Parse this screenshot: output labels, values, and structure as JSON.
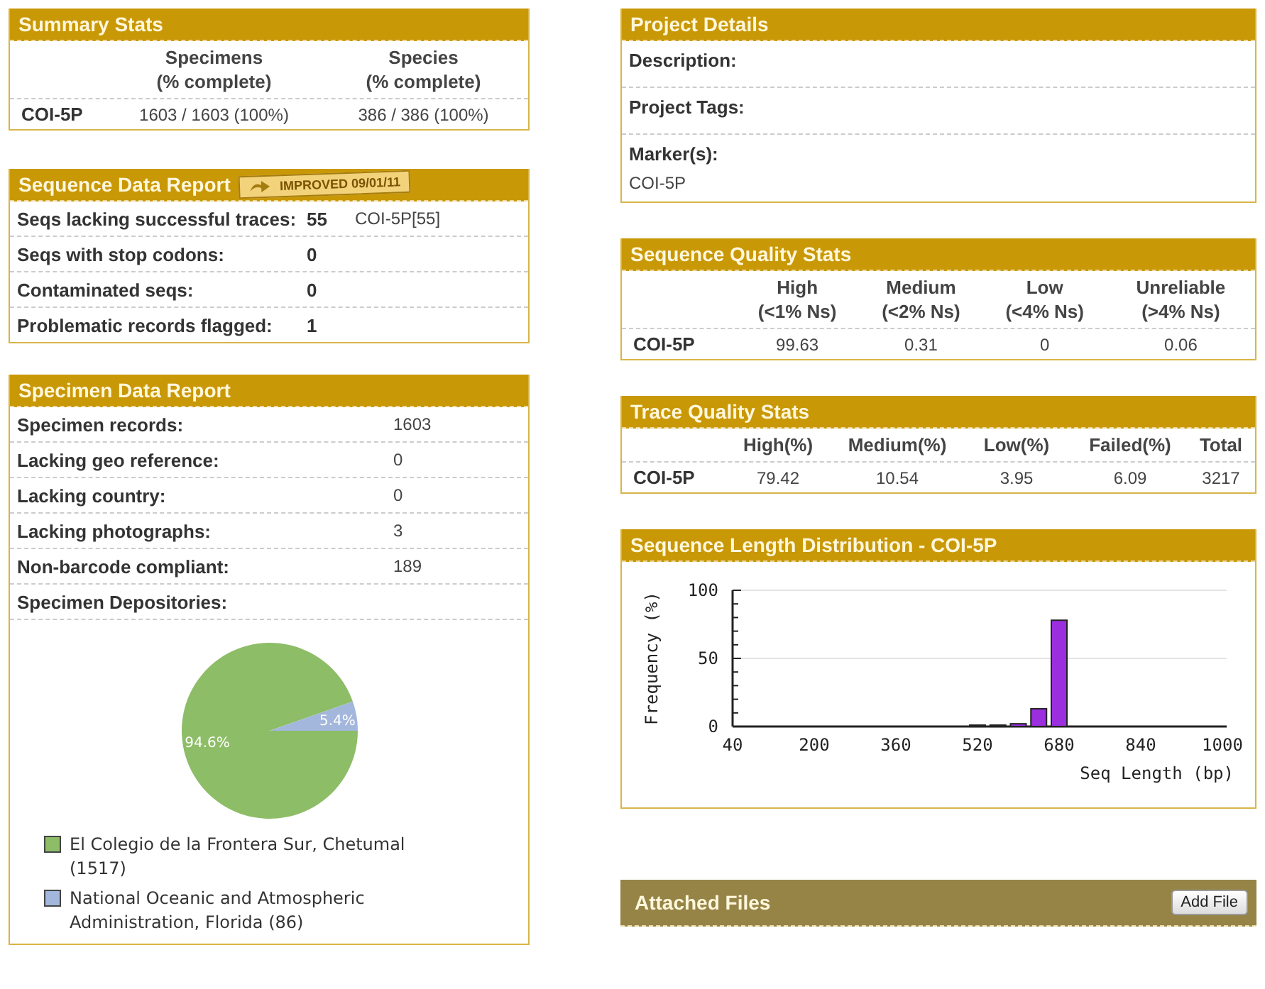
{
  "summary_stats": {
    "title": "Summary Stats",
    "columns": [
      {
        "label": "Specimens",
        "sub": "(% complete)"
      },
      {
        "label": "Species",
        "sub": "(% complete)"
      }
    ],
    "rows": [
      {
        "marker": "COI-5P",
        "cells": [
          "1603 / 1603  (100%)",
          "386 / 386  (100%)"
        ]
      }
    ]
  },
  "sequence_data_report": {
    "title": "Sequence Data Report",
    "badge": {
      "text": "IMPROVED",
      "date": "09/01/11"
    },
    "rows": [
      {
        "label": "Seqs lacking successful traces:",
        "value": "55",
        "extra": "COI-5P[55]"
      },
      {
        "label": "Seqs with stop codons:",
        "value": "0"
      },
      {
        "label": "Contaminated seqs:",
        "value": "0"
      },
      {
        "label": "Problematic records flagged:",
        "value": "1"
      }
    ]
  },
  "specimen_data_report": {
    "title": "Specimen Data Report",
    "rows": [
      {
        "label": "Specimen records:",
        "value": "1603"
      },
      {
        "label": "Lacking geo reference:",
        "value": "0"
      },
      {
        "label": "Lacking country:",
        "value": "0"
      },
      {
        "label": "Lacking photographs:",
        "value": "3"
      },
      {
        "label": "Non-barcode compliant:",
        "value": "189"
      }
    ],
    "depositories_label": "Specimen Depositories:",
    "chart_data": {
      "type": "pie",
      "values": [
        94.6,
        5.4
      ],
      "value_labels": [
        "94.6%",
        "5.4%"
      ]
    },
    "legend": [
      {
        "label": "El Colegio de la Frontera Sur, Chetumal (1517)",
        "color": "#8dbd67"
      },
      {
        "label": "National Oceanic and Atmospheric Administration, Florida (86)",
        "color": "#a3b6dc"
      }
    ]
  },
  "project_details": {
    "title": "Project Details",
    "rows": [
      {
        "label": "Description:"
      },
      {
        "label": "Project Tags:"
      },
      {
        "label": "Marker(s):",
        "value": "COI-5P"
      }
    ]
  },
  "sequence_quality_stats": {
    "title": "Sequence Quality Stats",
    "columns": [
      {
        "label": "High",
        "sub": "(<1% Ns)"
      },
      {
        "label": "Medium",
        "sub": "(<2% Ns)"
      },
      {
        "label": "Low",
        "sub": "(<4% Ns)"
      },
      {
        "label": "Unreliable",
        "sub": "(>4% Ns)"
      }
    ],
    "rows": [
      {
        "marker": "COI-5P",
        "cells": [
          "99.63",
          "0.31",
          "0",
          "0.06"
        ]
      }
    ]
  },
  "trace_quality_stats": {
    "title": "Trace Quality Stats",
    "columns": [
      {
        "label": "High(%)"
      },
      {
        "label": "Medium(%)"
      },
      {
        "label": "Low(%)"
      },
      {
        "label": "Failed(%)"
      },
      {
        "label": "Total"
      }
    ],
    "rows": [
      {
        "marker": "COI-5P",
        "cells": [
          "79.42",
          "10.54",
          "3.95",
          "6.09",
          "3217"
        ]
      }
    ]
  },
  "length_distribution": {
    "title": "Sequence Length Distribution - COI-5P",
    "chart_data": {
      "type": "bar",
      "xlabel": "Seq Length (bp)",
      "ylabel": "Frequency (%)",
      "x": [
        520,
        560,
        600,
        640,
        680
      ],
      "series": [
        {
          "color": "#9b2fe0",
          "values": [
            1,
            1,
            2,
            13,
            78
          ]
        }
      ],
      "xlim": [
        40,
        1000
      ],
      "ylim": [
        0,
        100
      ],
      "xticks": [
        40,
        200,
        360,
        520,
        680,
        840,
        1000
      ],
      "yticks": [
        0,
        50,
        100
      ]
    }
  },
  "attached_files": {
    "title": "Attached Files",
    "button": "Add File"
  }
}
